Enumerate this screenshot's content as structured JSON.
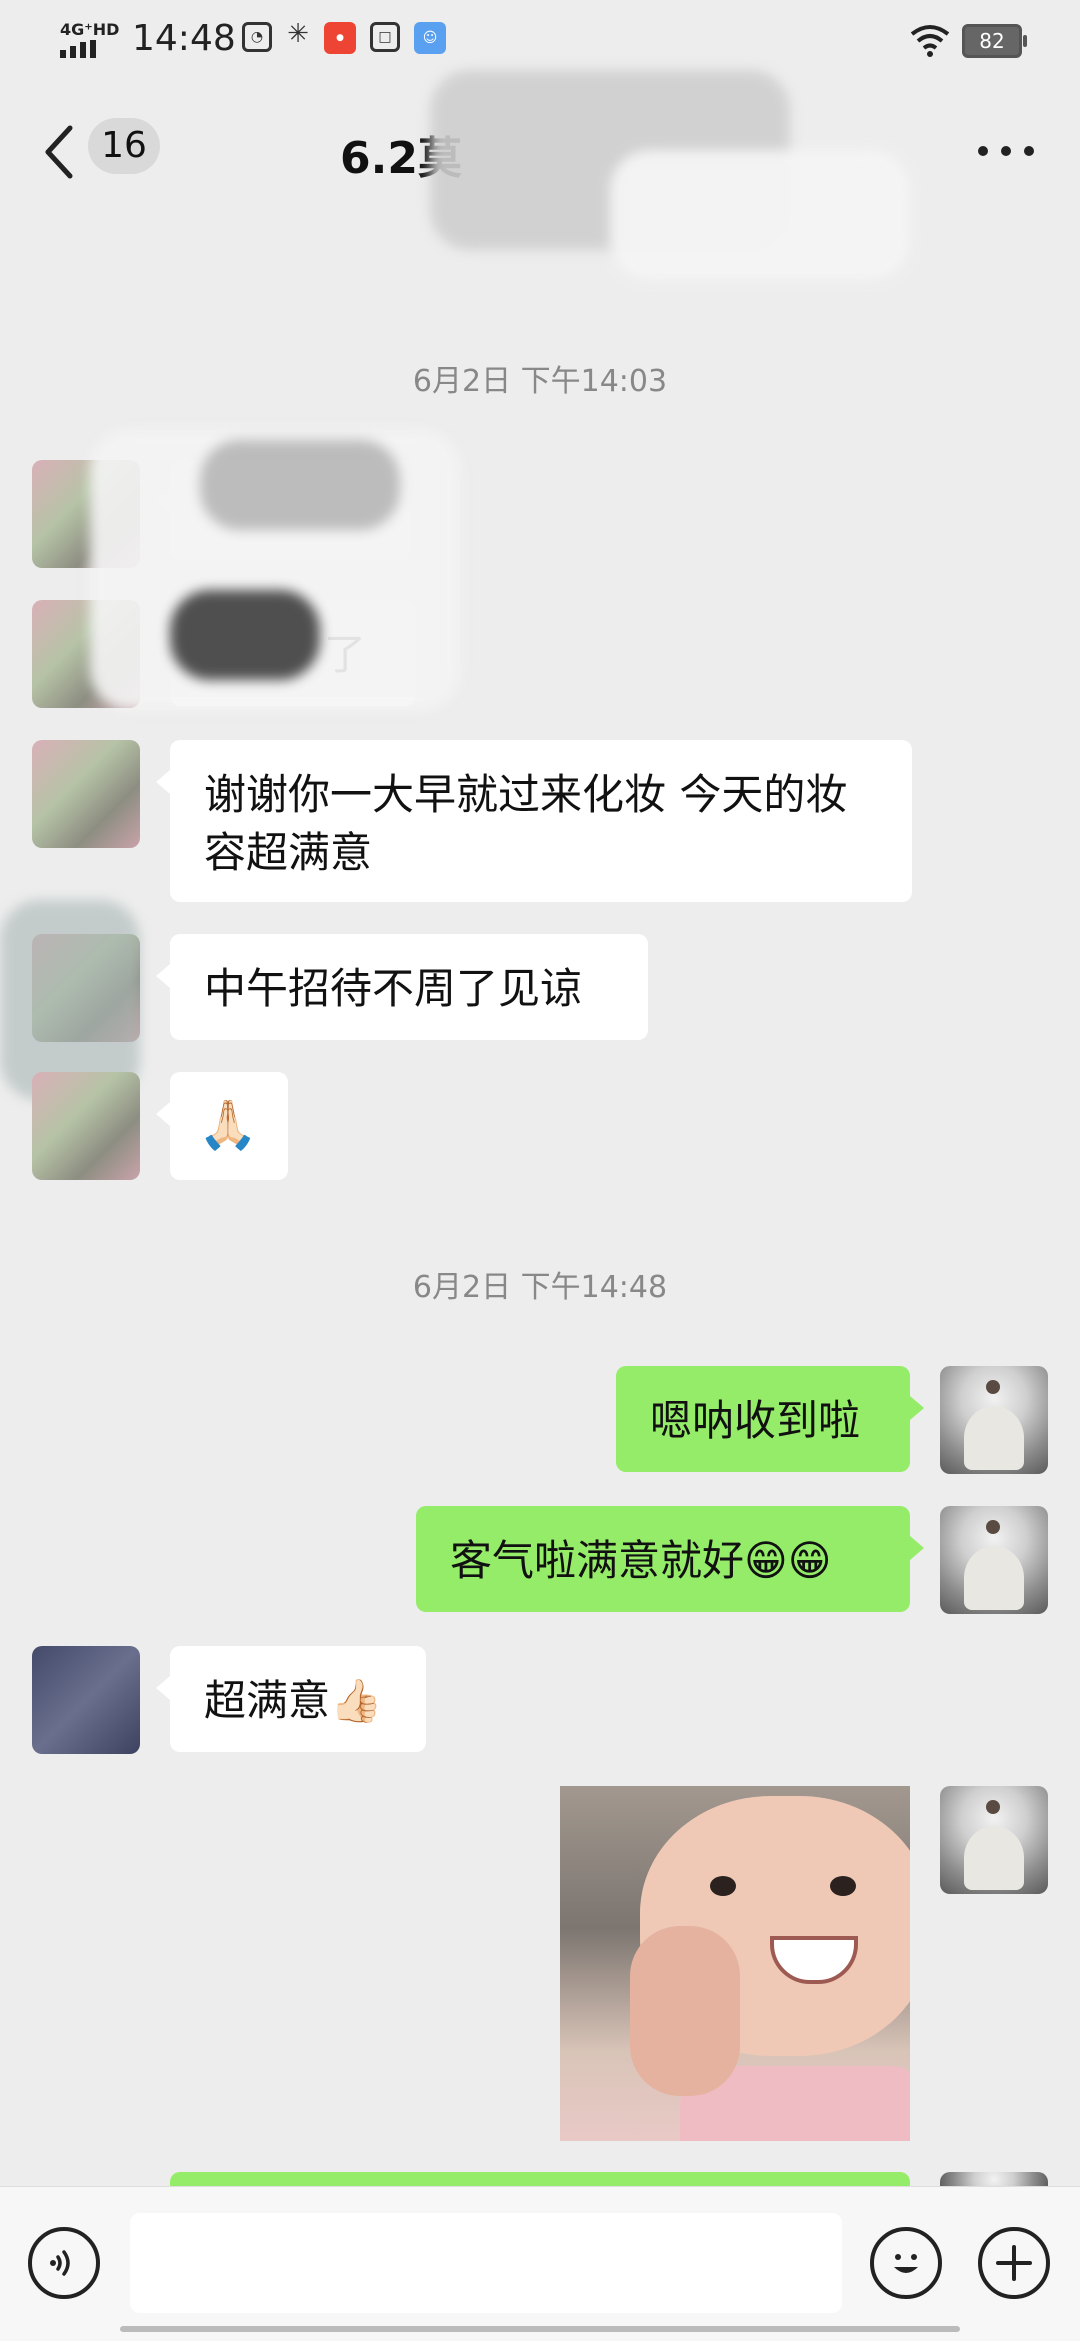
{
  "status_bar": {
    "network": "4G⁺HD",
    "time": "14:48",
    "battery": "82"
  },
  "header": {
    "unread_count": "16",
    "title": "6.2莫"
  },
  "messages": {
    "timestamp_1": "6月2日 下午14:03",
    "incoming_1_tail": "了",
    "incoming_2": "谢谢你一大早就过来化妆 今天的妆容超满意",
    "incoming_3": "中午招待不周了见谅",
    "incoming_4": "🙏🏻",
    "timestamp_2": "6月2日 下午14:48",
    "outgoing_1": "嗯呐收到啦",
    "outgoing_2": "客气啦满意就好😁😁",
    "incoming_5": "超满意👍🏻"
  },
  "composer": {
    "input_value": "",
    "voice_icon": "voice-icon",
    "emoji_icon": "emoji-icon",
    "plus_icon": "plus-icon"
  },
  "colors": {
    "background": "#ededed",
    "outgoing_bubble": "#95ec69",
    "incoming_bubble": "#ffffff"
  }
}
